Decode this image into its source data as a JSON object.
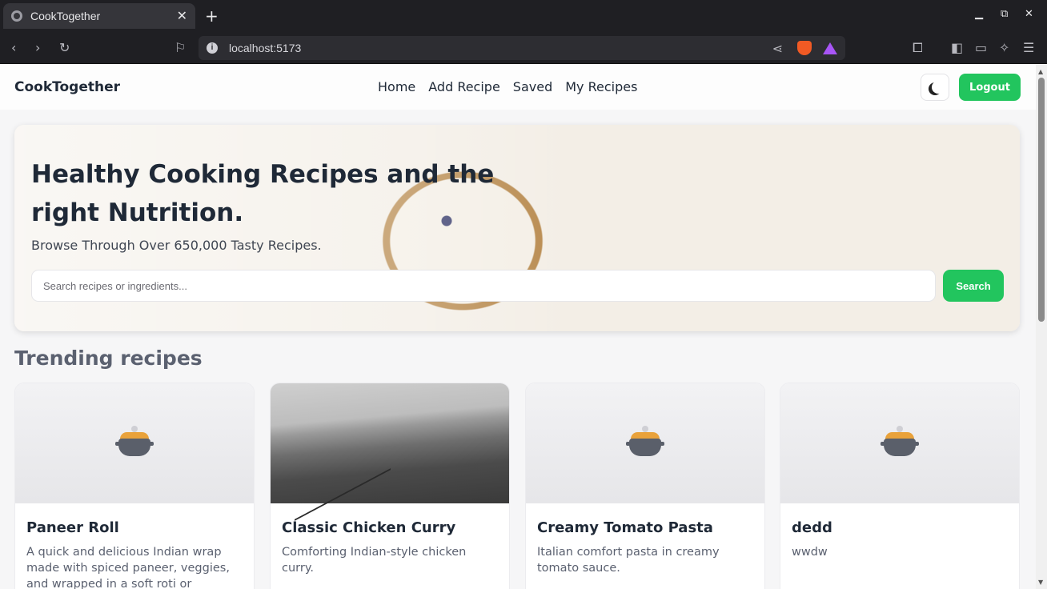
{
  "browser": {
    "tab_title": "CookTogether",
    "url": "localhost:5173"
  },
  "nav": {
    "brand": "CookTogether",
    "links": [
      "Home",
      "Add Recipe",
      "Saved",
      "My Recipes"
    ],
    "logout_label": "Logout"
  },
  "hero": {
    "title": "Healthy Cooking Recipes and the right Nutrition.",
    "subtitle": "Browse Through Over 650,000 Tasty Recipes.",
    "search_placeholder": "Search recipes or ingredients...",
    "search_button": "Search"
  },
  "trending": {
    "title": "Trending recipes",
    "cards": [
      {
        "title": "Paneer Roll",
        "description": "A quick and delicious Indian wrap made with spiced paneer, veggies, and wrapped in a soft roti or paratha…",
        "image": "pot-icon"
      },
      {
        "title": "Classic Chicken Curry",
        "description": "Comforting Indian-style chicken curry.",
        "image": "landscape-photo"
      },
      {
        "title": "Creamy Tomato Pasta",
        "description": "Italian comfort pasta in creamy tomato sauce.",
        "image": "pot-icon"
      },
      {
        "title": "dedd",
        "description": "wwdw",
        "image": "pot-icon"
      }
    ]
  },
  "colors": {
    "accent": "#22c55e",
    "text": "#1f2937"
  }
}
